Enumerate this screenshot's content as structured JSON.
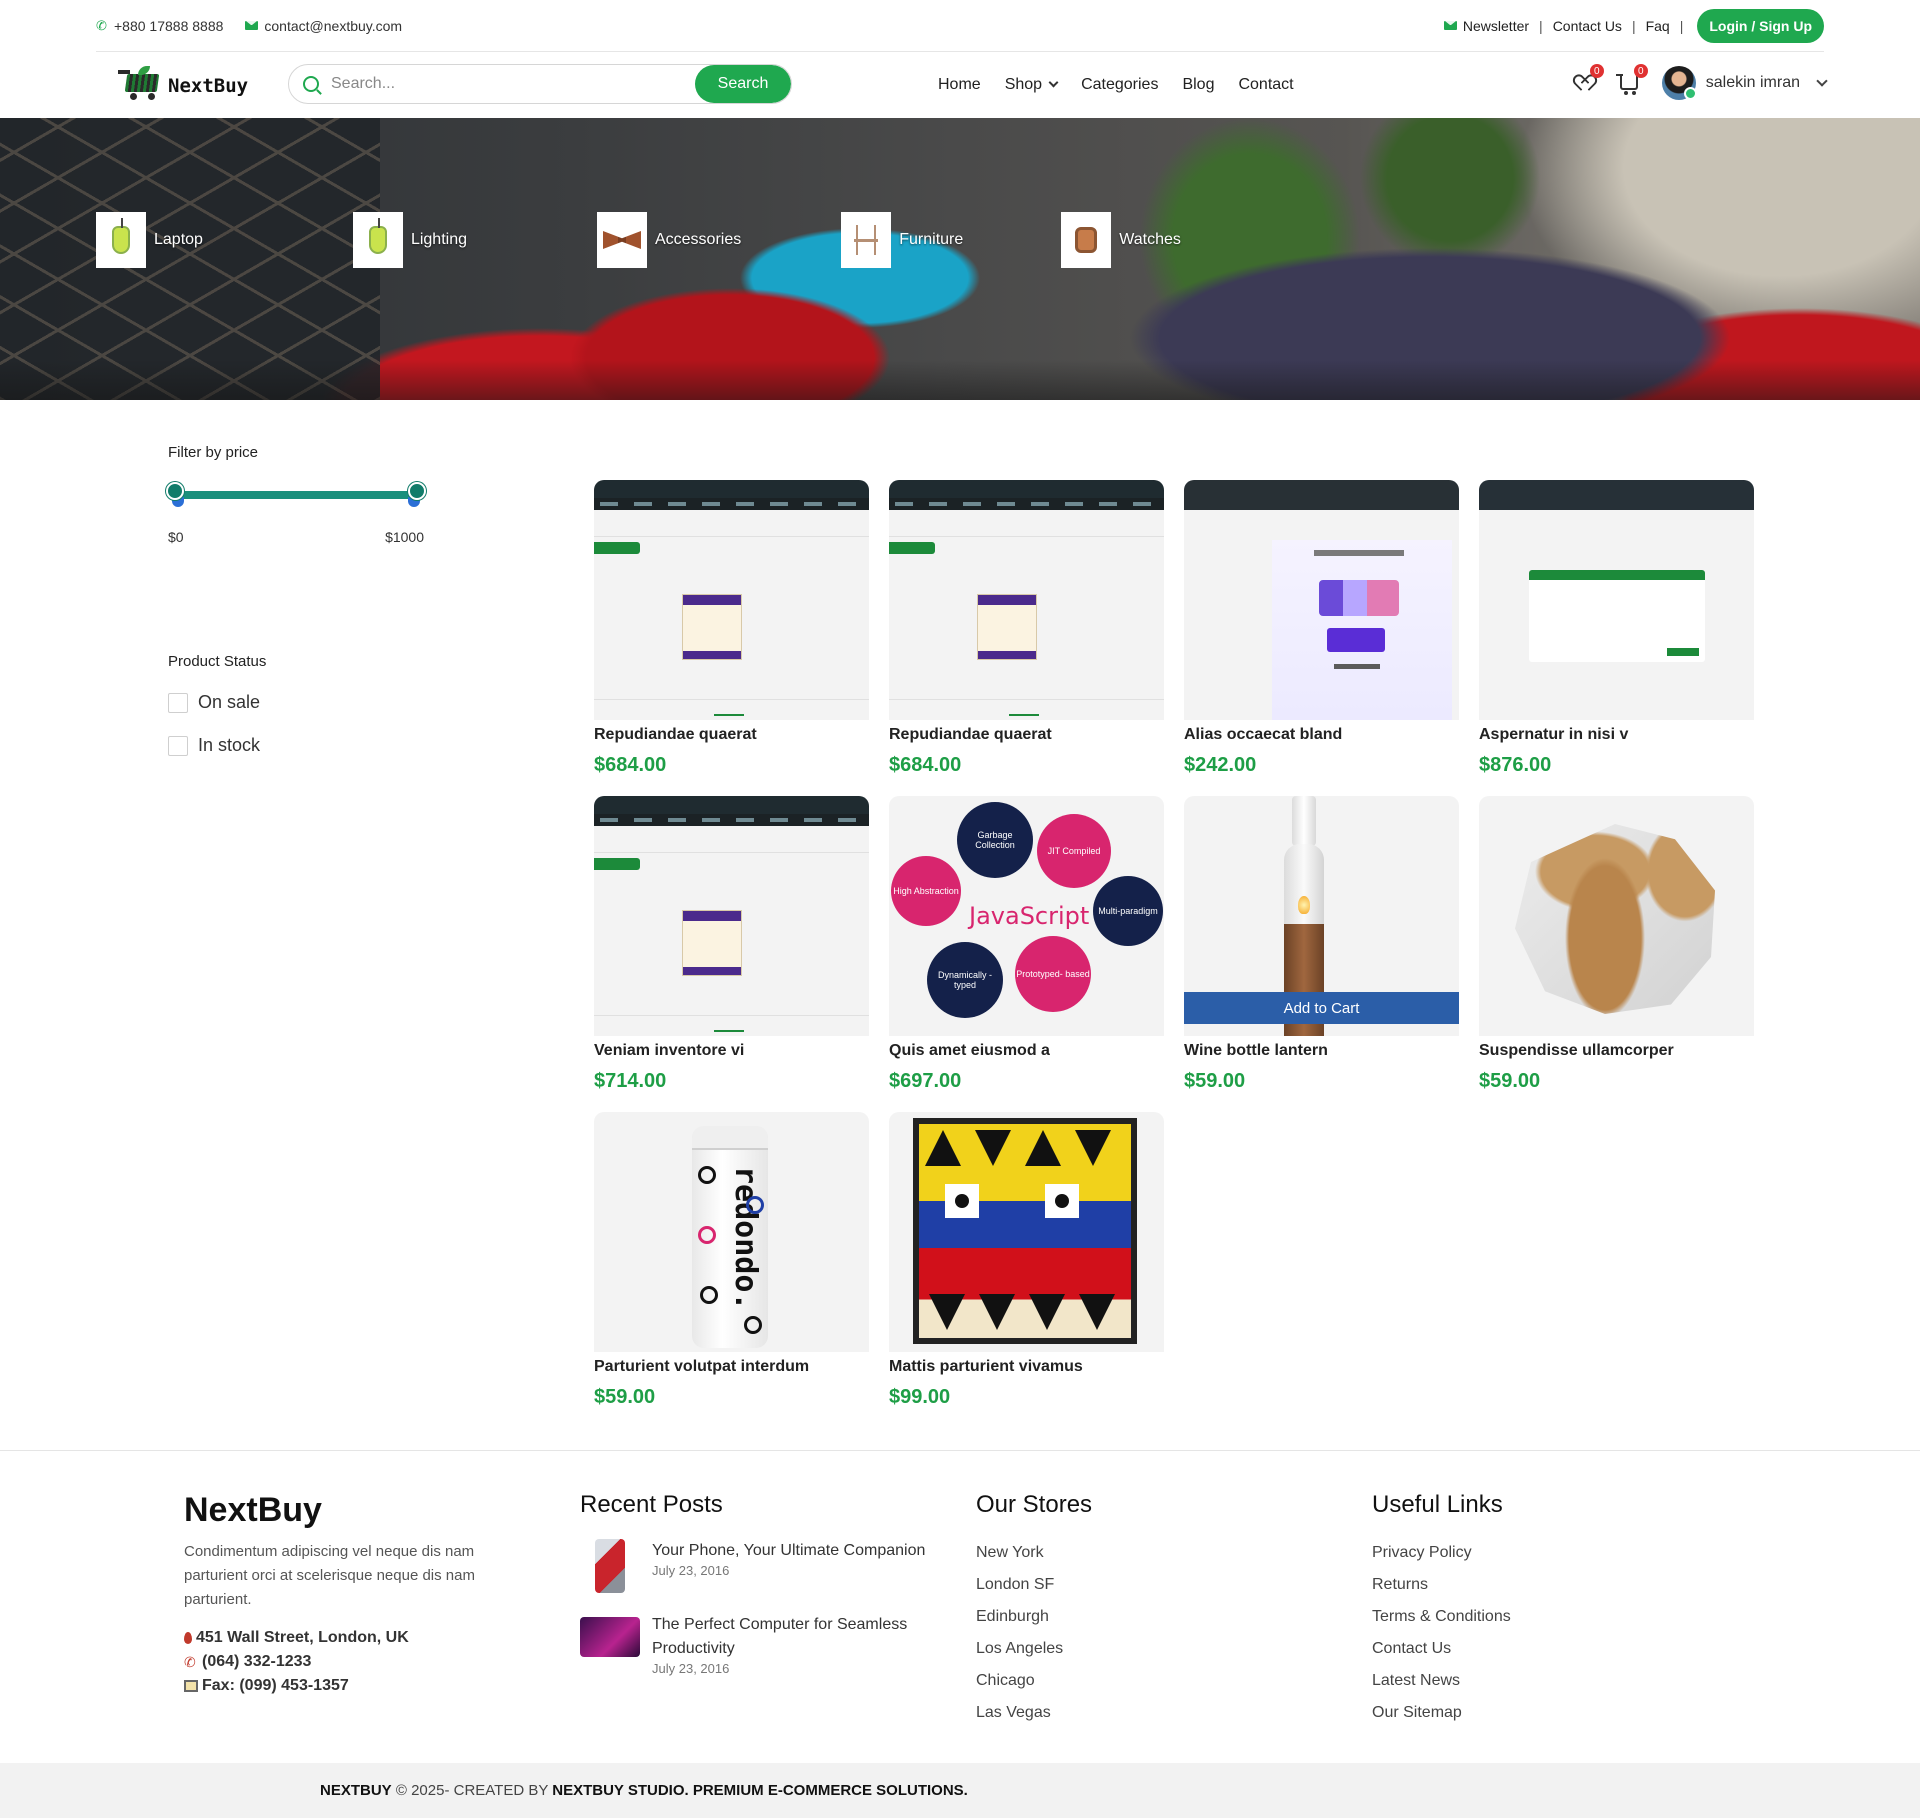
{
  "topbar": {
    "phone": "+880 17888 8888",
    "email": "contact@nextbuy.com",
    "links": [
      "Newsletter",
      "Contact Us",
      "Faq"
    ],
    "login_label": "Login / Sign Up"
  },
  "nav": {
    "logo_text": "NextBuy",
    "search_placeholder": "Search...",
    "search_button": "Search",
    "menu": [
      "Home",
      "Shop",
      "Categories",
      "Blog",
      "Contact"
    ],
    "wishlist_count": "0",
    "cart_count": "0",
    "user_name": "salekin imran"
  },
  "hero": {
    "categories": [
      "Laptop",
      "Lighting",
      "Accessories",
      "Furniture",
      "Watches"
    ]
  },
  "filters": {
    "price_title": "Filter by price",
    "price_min": "$0",
    "price_max": "$1000",
    "status_title": "Product Status",
    "options": [
      "On sale",
      "In stock"
    ]
  },
  "products": [
    {
      "name": "Repudiandae quaerat",
      "price": "$684.00"
    },
    {
      "name": "Repudiandae quaerat",
      "price": "$684.00"
    },
    {
      "name": "Alias occaecat bland",
      "price": "$242.00"
    },
    {
      "name": "Aspernatur in nisi v",
      "price": "$876.00"
    },
    {
      "name": "Veniam inventore vi",
      "price": "$714.00"
    },
    {
      "name": "Quis amet eiusmod a",
      "price": "$697.00"
    },
    {
      "name": "Wine bottle lantern",
      "price": "$59.00"
    },
    {
      "name": "Suspendisse ullamcorper",
      "price": "$59.00"
    },
    {
      "name": "Parturient volutpat interdum",
      "price": "$59.00"
    },
    {
      "name": "Mattis parturient vivamus",
      "price": "$99.00"
    }
  ],
  "add_to_cart_label": "Add to Cart",
  "product_image_text": {
    "js_word": "JavaScript",
    "js_bubbles": [
      "Garbage Collection",
      "JIT Compiled",
      "High Abstraction",
      "Multi-paradigm",
      "Dynamically -typed",
      "Prototyped- based"
    ],
    "can_word": "redondo."
  },
  "footer": {
    "brand": "NextBuy",
    "description": "Condimentum adipiscing vel neque dis nam parturient orci at scelerisque neque dis nam parturient.",
    "address": "451 Wall Street, London, UK",
    "phone": "(064) 332-1233",
    "fax": "Fax: (099) 453-1357",
    "posts_title": "Recent Posts",
    "posts": [
      {
        "title": "Your Phone, Your Ultimate Companion",
        "date": "July 23, 2016"
      },
      {
        "title": "The Perfect Computer for Seamless Productivity",
        "date": "July 23, 2016"
      }
    ],
    "stores_title": "Our Stores",
    "stores": [
      "New York",
      "London SF",
      "Edinburgh",
      "Los Angeles",
      "Chicago",
      "Las Vegas"
    ],
    "links_title": "Useful Links",
    "links": [
      "Privacy Policy",
      "Returns",
      "Terms & Conditions",
      "Contact Us",
      "Latest News",
      "Our Sitemap"
    ]
  },
  "copyright": {
    "brand": "NEXTBUY",
    "text": " © 2025- CREATED BY ",
    "studio": "NEXTBUY STUDIO. PREMIUM E-COMMERCE SOLUTIONS."
  }
}
